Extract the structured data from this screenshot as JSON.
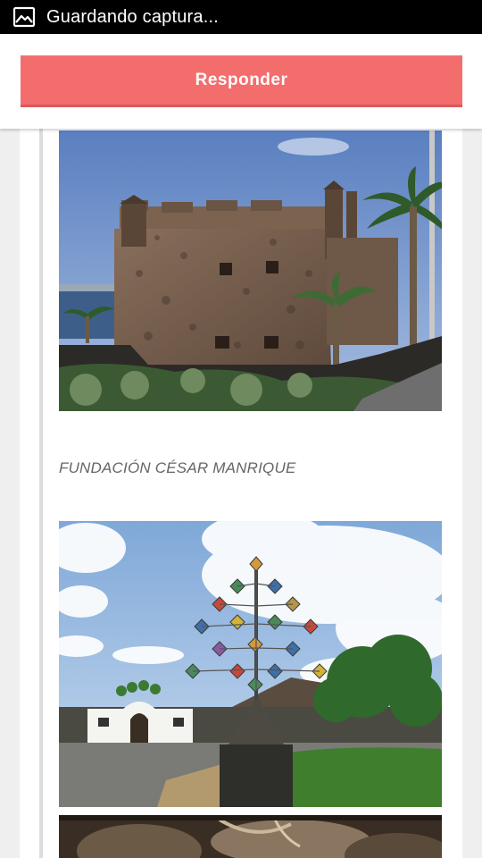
{
  "status_bar": {
    "icon": "image-icon",
    "text": "Guardando captura..."
  },
  "header": {
    "reply_label": "Responder",
    "reply_color": "#f46d6d"
  },
  "post": {
    "images": [
      {
        "name": "castillo-san-gabriel-photo"
      },
      {
        "name": "fundacion-cesar-manrique-photo"
      },
      {
        "name": "cave-photo"
      }
    ],
    "caption": "FUNDACIÓN CÉSAR MANRIQUE"
  }
}
